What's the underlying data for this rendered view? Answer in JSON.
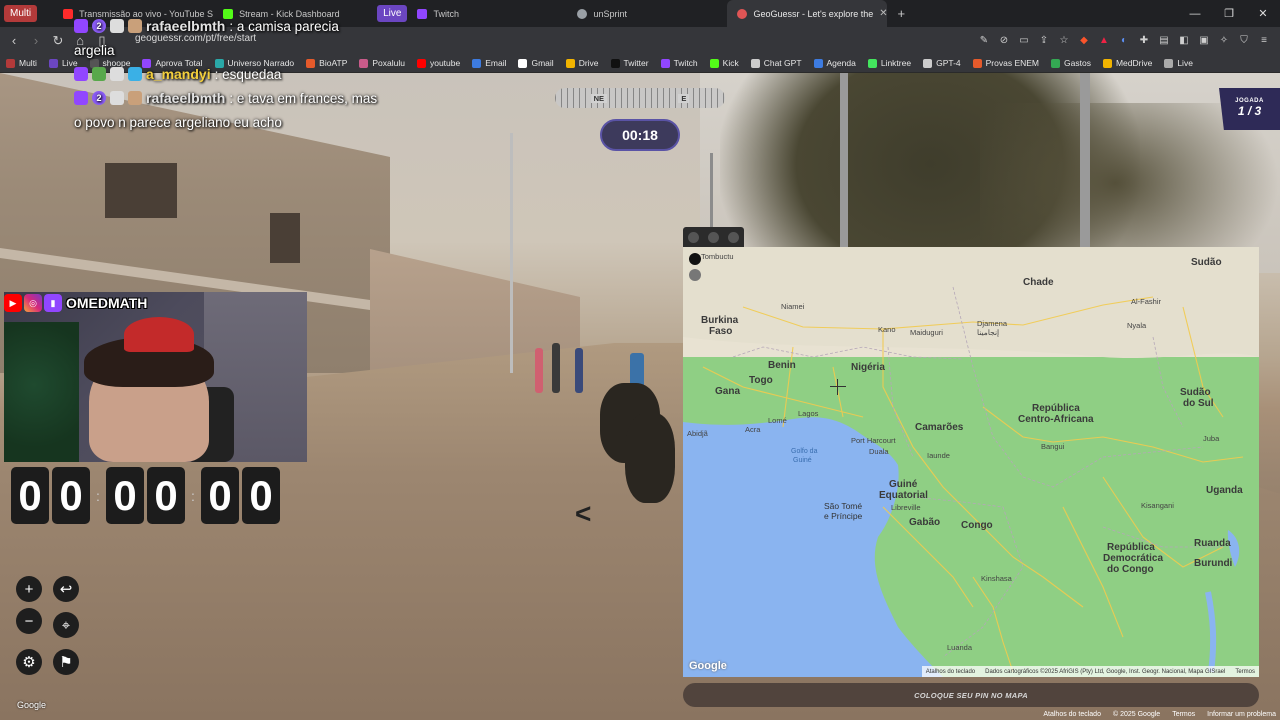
{
  "browser": {
    "ext_multi": "Multi",
    "ext_live": "Live",
    "tabs": [
      {
        "title": "Transmissão ao vivo - YouTube Studio",
        "color": "#ff2b2b"
      },
      {
        "title": "Stream - Kick Dashboard",
        "color": "#53fc18"
      },
      {
        "title": "Live",
        "color": "#9146ff"
      },
      {
        "title": "Twitch",
        "color": "#9146ff"
      },
      {
        "title": "unSprint",
        "color": "#9aa0a6"
      },
      {
        "title": "GeoGuessr - Let's explore the",
        "color": "#e0e0e0"
      }
    ],
    "new_tab": "+",
    "url": "geoguessr.com/pt/free/start",
    "bookmarks": [
      {
        "label": "Multi",
        "color": "#b33a3a"
      },
      {
        "label": "Live",
        "color": "#6b46c1"
      },
      {
        "label": "shoope",
        "color": "#555"
      },
      {
        "label": "Aprova Total",
        "color": "#9146ff"
      },
      {
        "label": "Universo Narrado",
        "color": "#2aa8a8"
      },
      {
        "label": "BioATP",
        "color": "#e55a2b"
      },
      {
        "label": "Poxalulu",
        "color": "#c95b8a"
      },
      {
        "label": "youtube",
        "color": "#ff0000"
      },
      {
        "label": "Email",
        "color": "#3d7be0"
      },
      {
        "label": "Gmail",
        "color": "#ffffff"
      },
      {
        "label": "Drive",
        "color": "#f2b400"
      },
      {
        "label": "Twitter",
        "color": "#111111"
      },
      {
        "label": "Twitch",
        "color": "#9146ff"
      },
      {
        "label": "Kick",
        "color": "#53fc18"
      },
      {
        "label": "Chat GPT",
        "color": "#cccccc"
      },
      {
        "label": "Agenda",
        "color": "#3d7be0"
      },
      {
        "label": "Linktree",
        "color": "#43e55e"
      },
      {
        "label": "GPT-4",
        "color": "#cccccc"
      },
      {
        "label": "Provas ENEM",
        "color": "#e55a2b"
      },
      {
        "label": "Gastos",
        "color": "#34a853"
      },
      {
        "label": "MedDrive",
        "color": "#f2b400"
      },
      {
        "label": "Live",
        "color": "#aaaaaa"
      }
    ]
  },
  "chat": {
    "line1_user": "rafaeelbmth",
    "line1_text": ": a camisa parecia",
    "line1_cont": "argelia",
    "line2_user": "a_mandyi",
    "line2_text": ": esquedaa",
    "line3_user": "rafaeelbmth",
    "line3_text": ": e tava em frances, mas",
    "line3_cont": "o povo n parece argeliano eu acho",
    "badge_count": "2"
  },
  "hud": {
    "compass_ne": "NE",
    "compass_e": "E",
    "timer": "00:18",
    "round_label": "JOGADA",
    "round_value": "1 / 3"
  },
  "webcam": {
    "name": "OMEDMATH"
  },
  "clock": {
    "digits": [
      "0",
      "0",
      "0",
      "0",
      "0",
      "0"
    ]
  },
  "controls": {
    "zoom_in": "+",
    "zoom_out": "−",
    "undo": "↩",
    "pin": "⌖",
    "settings": "⚙",
    "flag": "⚑",
    "watermark": "Google"
  },
  "map": {
    "labels": {
      "tombuctu": "Tombuctu",
      "niamei": "Niamei",
      "burkina": "Burkina",
      "faso": "Faso",
      "benin": "Benin",
      "togo": "Togo",
      "gana": "Gana",
      "nigeria": "Nigéria",
      "kano": "Kano",
      "maiduguri": "Maiduguri",
      "chade": "Chade",
      "djamena": "Djamena",
      "djamena_ar": "إنجامينا",
      "sudao": "Sudão",
      "al_fashir": "Al-Fashir",
      "nyala": "Nyala",
      "sudao_sul_1": "Sudão",
      "sudao_sul_2": "do Sul",
      "abidja": "Abidjã",
      "acra": "Acra",
      "lome": "Lomé",
      "lagos": "Lagos",
      "golfo": "Golfo da",
      "guine_golfo": "Guiné",
      "port_harcourt": "Port Harcourt",
      "camaroes": "Camarões",
      "duala": "Duala",
      "iaunde": "Iaunde",
      "rca_1": "República",
      "rca_2": "Centro-Africana",
      "bangui": "Bangui",
      "juba": "Juba",
      "guine_eq_1": "Guiné",
      "guine_eq_2": "Equatorial",
      "sao_tome_1": "São Tomé",
      "sao_tome_2": "e Príncipe",
      "libreville": "Libreville",
      "gabao": "Gabão",
      "congo": "Congo",
      "uganda": "Uganda",
      "kisangani": "Kisangani",
      "rdc_1": "República",
      "rdc_2": "Democrática",
      "rdc_3": "do Congo",
      "ruanda": "Ruanda",
      "burundi": "Burundi",
      "kinshasa": "Kinshasa",
      "luanda": "Luanda"
    },
    "google": "Google",
    "attrib_shortcuts": "Atalhos do teclado",
    "attrib_data": "Dados cartográficos ©2025 AfriGIS (Pty) Ltd, Google, Inst. Geogr. Nacional, Mapa GISrael",
    "attrib_terms": "Termos"
  },
  "guess_button": "COLOQUE SEU PIN NO MAPA",
  "footer": {
    "shortcuts": "Atalhos do teclado",
    "copyright": "© 2025 Google",
    "terms": "Termos",
    "report": "Informar um problema"
  }
}
